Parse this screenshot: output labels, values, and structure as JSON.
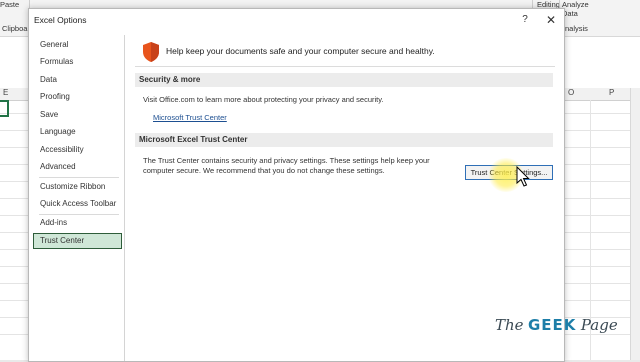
{
  "excel": {
    "ribbon": {
      "paste_label": "Paste",
      "clipboard_label": "Clipboa",
      "editing_label": "Editing",
      "analyze_label": "Analyze",
      "data_label": "Data",
      "analysis_label": "nalysis"
    },
    "columns": [
      "E",
      "O",
      "P"
    ]
  },
  "dialog": {
    "title": "Excel Options",
    "help_label": "?",
    "close_label": "✕",
    "sidebar": {
      "items": [
        {
          "label": "General"
        },
        {
          "label": "Formulas"
        },
        {
          "label": "Data"
        },
        {
          "label": "Proofing"
        },
        {
          "label": "Save"
        },
        {
          "label": "Language"
        },
        {
          "label": "Accessibility"
        },
        {
          "label": "Advanced"
        },
        {
          "label": "Customize Ribbon"
        },
        {
          "label": "Quick Access Toolbar"
        },
        {
          "label": "Add-ins"
        },
        {
          "label": "Trust Center"
        }
      ],
      "selected": "Trust Center"
    },
    "banner": {
      "icon": "shield-icon",
      "text": "Help keep your documents safe and your computer secure and healthy."
    },
    "security_section": {
      "header": "Security & more",
      "description": "Visit Office.com to learn more about protecting your privacy and security.",
      "link": "Microsoft Trust Center"
    },
    "trust_center_section": {
      "header": "Microsoft Excel Trust Center",
      "description_line1": "The Trust Center contains security and privacy settings. These settings help keep your",
      "description_line2": "computer secure. We recommend that you do not change these settings.",
      "button_label": "Trust Center Settings..."
    }
  },
  "watermark": {
    "the": "The",
    "geek": "GEEK",
    "page": "Page"
  },
  "colors": {
    "selected_nav_bg": "#cfe7d7",
    "selected_nav_border": "#2e5d3a",
    "shield": "#e8541c",
    "link": "#1d4f91",
    "button_border": "#2f6fb6",
    "cursor_highlight": "#ffeb3c"
  }
}
